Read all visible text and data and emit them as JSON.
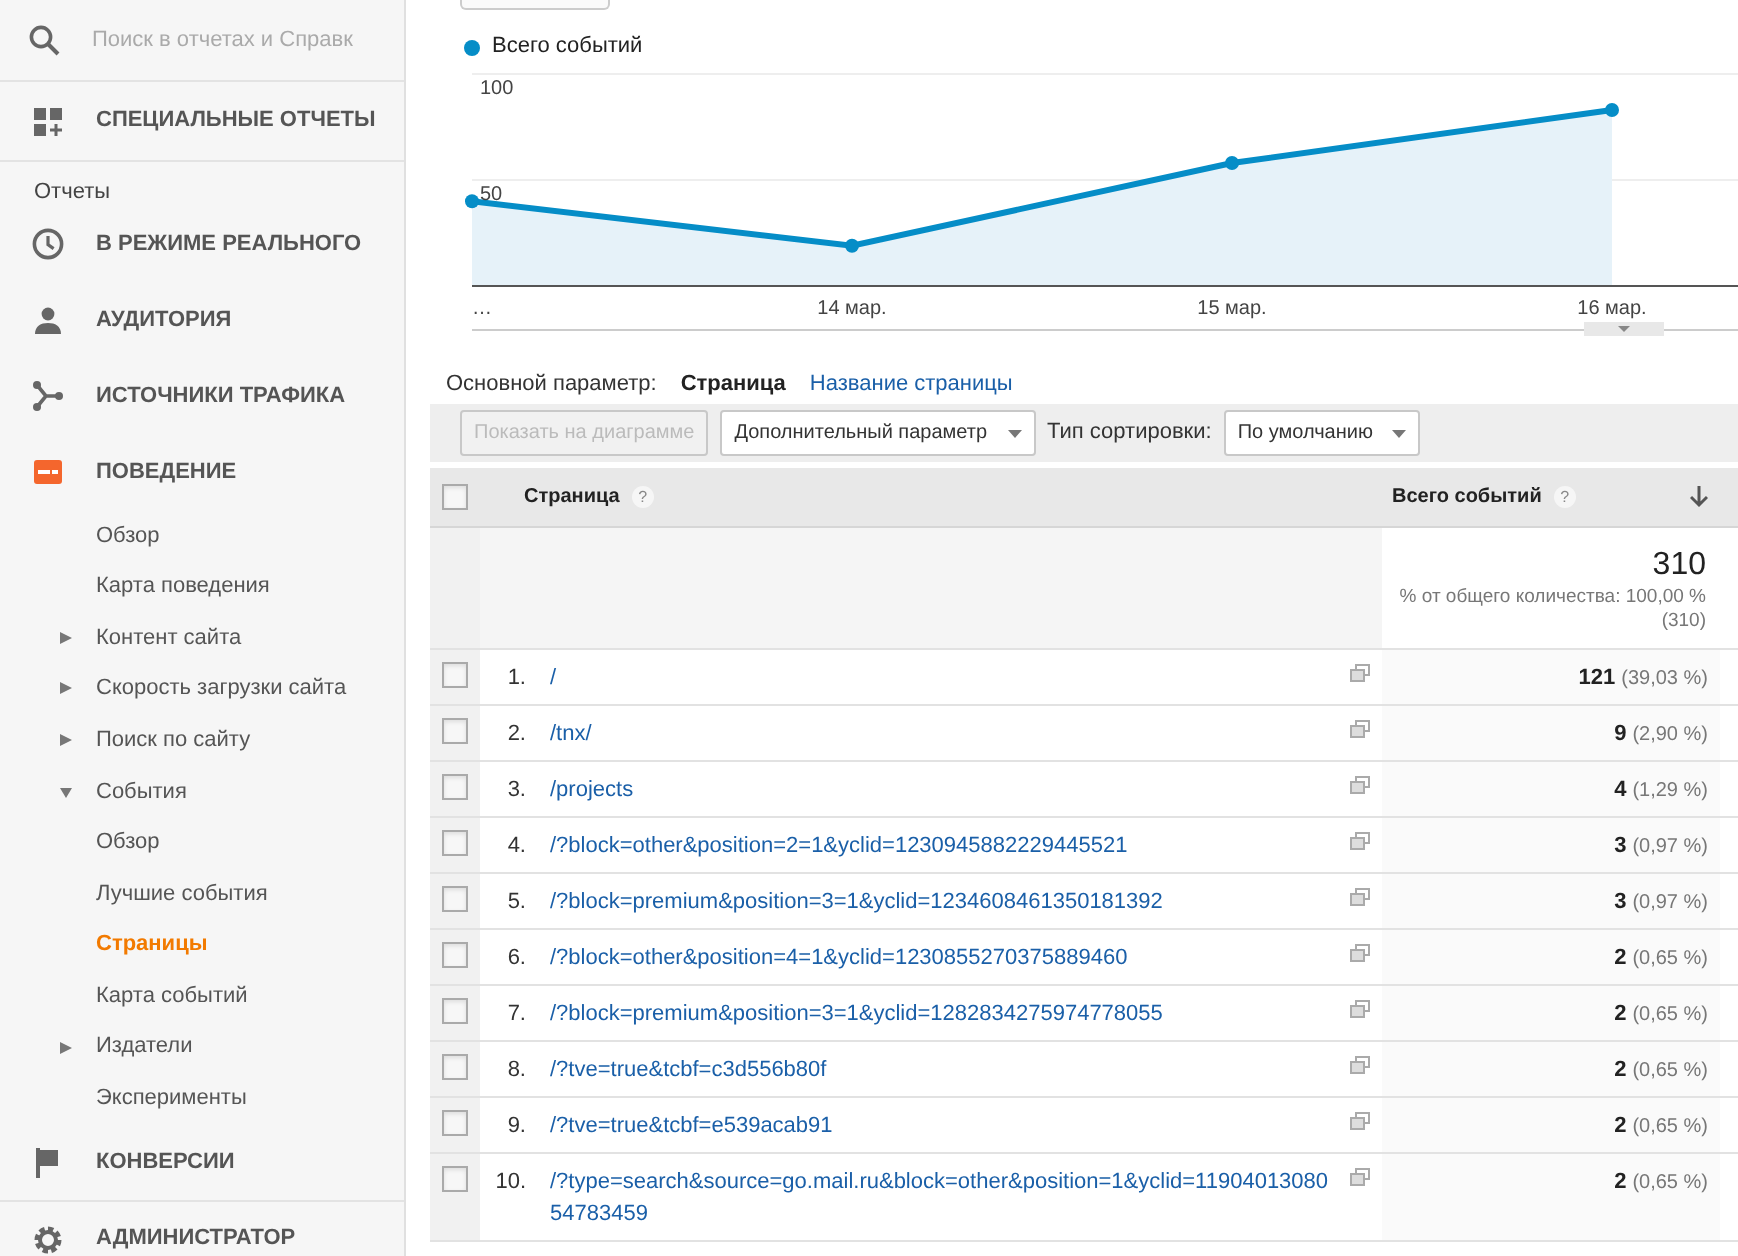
{
  "search": {
    "placeholder": "Поиск в отчетах и Справк"
  },
  "custom_reports": {
    "label": "СПЕЦИАЛЬНЫЕ ОТЧЕТЫ"
  },
  "reports_heading": "Отчеты",
  "sections": [
    {
      "label": "В РЕЖИМЕ РЕАЛЬНОГО",
      "selected": false
    },
    {
      "label": "АУДИТОРИЯ",
      "selected": false
    },
    {
      "label": "ИСТОЧНИКИ ТРАФИКА",
      "selected": false
    },
    {
      "label": "ПОВЕДЕНИЕ",
      "selected": true,
      "children": [
        {
          "label": "Обзор",
          "kind": "link",
          "selected": false
        },
        {
          "label": "Карта поведения",
          "kind": "link",
          "selected": false
        },
        {
          "label": "Контент сайта",
          "kind": "expandable",
          "expanded": false,
          "selected": false
        },
        {
          "label": "Скорость загрузки сайта",
          "kind": "expandable",
          "expanded": false,
          "selected": false
        },
        {
          "label": "Поиск по сайту",
          "kind": "expandable",
          "expanded": false,
          "selected": false
        },
        {
          "label": "События",
          "kind": "expandable",
          "expanded": true,
          "selected": false,
          "children": [
            {
              "label": "Обзор",
              "kind": "link",
              "selected": false
            },
            {
              "label": "Лучшие события",
              "kind": "link",
              "selected": false
            },
            {
              "label": "Страницы",
              "kind": "link",
              "selected": true
            },
            {
              "label": "Карта событий",
              "kind": "link",
              "selected": false
            }
          ]
        },
        {
          "label": "Издатели",
          "kind": "expandable",
          "expanded": false,
          "selected": false
        },
        {
          "label": "Эксперименты",
          "kind": "link",
          "selected": false
        }
      ]
    },
    {
      "label": "КОНВЕРСИИ",
      "selected": false
    }
  ],
  "admin": {
    "label": "АДМИНИСТРАТОР"
  },
  "chart": {
    "chart_data": {
      "type": "area",
      "categories": [
        "…",
        "14 мар.",
        "15 мар.",
        "16 мар."
      ],
      "series": [
        {
          "name": "Всего событий",
          "color": "#058dc7",
          "values": [
            40,
            19,
            58,
            83
          ]
        }
      ],
      "yticks": [
        50,
        100
      ],
      "ylim": [
        0,
        100
      ]
    }
  },
  "dimension": {
    "label": "Основной параметр:",
    "options": [
      {
        "label": "Страница",
        "selected": true
      },
      {
        "label": "Название страницы",
        "selected": false
      }
    ]
  },
  "toolbar": {
    "chart_button": {
      "label": "Показать на диаграмме",
      "disabled": true
    },
    "secondary_dropdown": "Дополнительный параметр",
    "sort_label": "Тип сортировки:",
    "sort_dropdown": "По умолчанию"
  },
  "table": {
    "header_checkbox": {
      "checked": false
    },
    "columns": [
      {
        "label": "Страница",
        "help": "?"
      },
      {
        "label": "Всего событий",
        "help": "?",
        "sorted": true
      }
    ],
    "summary": {
      "value": "310",
      "share": "% от общего количества: 100,00 %",
      "total": "(310)"
    },
    "rows": [
      {
        "index": "1.",
        "page": "/",
        "value": "121",
        "percent": "(39,03 %)",
        "checked": false
      },
      {
        "index": "2.",
        "page": "/tnx/",
        "value": "9",
        "percent": "(2,90 %)",
        "checked": false
      },
      {
        "index": "3.",
        "page": "/projects",
        "value": "4",
        "percent": "(1,29 %)",
        "checked": false
      },
      {
        "index": "4.",
        "page": "/?block=other&position=2=1&yclid=1230945882229445521",
        "value": "3",
        "percent": "(0,97 %)",
        "checked": false
      },
      {
        "index": "5.",
        "page": "/?block=premium&position=3=1&yclid=1234608461350181392",
        "value": "3",
        "percent": "(0,97 %)",
        "checked": false
      },
      {
        "index": "6.",
        "page": "/?block=other&position=4=1&yclid=1230855270375889460",
        "value": "2",
        "percent": "(0,65 %)",
        "checked": false
      },
      {
        "index": "7.",
        "page": "/?block=premium&position=3=1&yclid=1282834275974778055",
        "value": "2",
        "percent": "(0,65 %)",
        "checked": false
      },
      {
        "index": "8.",
        "page": "/?tve=true&tcbf=c3d556b80f",
        "value": "2",
        "percent": "(0,65 %)",
        "checked": false
      },
      {
        "index": "9.",
        "page": "/?tve=true&tcbf=e539acab91",
        "value": "2",
        "percent": "(0,65 %)",
        "checked": false
      },
      {
        "index": "10.",
        "page": "/?type=search&source=go.mail.ru&block=other&position=1&yclid=1190401308054783459",
        "value": "2",
        "percent": "(0,65 %)",
        "checked": false
      }
    ]
  }
}
